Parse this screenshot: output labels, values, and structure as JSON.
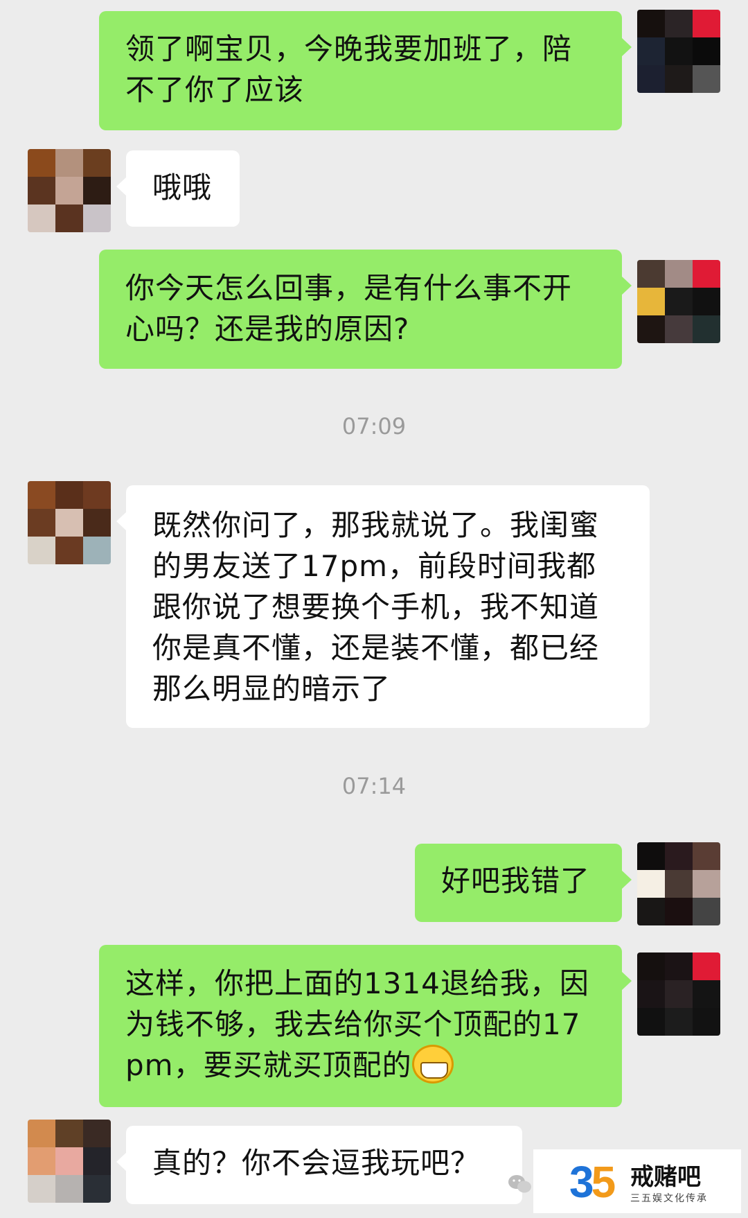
{
  "messages": [
    {
      "side": "out",
      "text": "领了啊宝贝，今晚我要加班了，陪不了你了应该"
    },
    {
      "side": "in",
      "text": "哦哦"
    },
    {
      "side": "out",
      "text": "你今天怎么回事，是有什么事不开心吗？还是我的原因?"
    },
    {
      "side": "in",
      "text": "既然你问了，那我就说了。我闺蜜的男友送了17pm，前段时间我都跟你说了想要换个手机，我不知道你是真不懂，还是装不懂，都已经那么明显的暗示了"
    },
    {
      "side": "out",
      "text": "好吧我错了"
    },
    {
      "side": "out",
      "text": "这样，你把上面的1314退给我，因为钱不够，我去给你买个顶配的17pm，要买就买顶配的"
    },
    {
      "side": "in",
      "text": "真的？你不会逗我玩吧？"
    }
  ],
  "timestamps": [
    "07:09",
    "07:14"
  ],
  "emoji": "grinning-face-emoji",
  "watermark": {
    "number_part1": "3",
    "number_part2": "5",
    "title": "戒赌吧",
    "subtitle": "三五娱文化传承"
  },
  "colors": {
    "outgoing_bubble": "#95ec69",
    "incoming_bubble": "#ffffff",
    "background": "#ececec"
  }
}
